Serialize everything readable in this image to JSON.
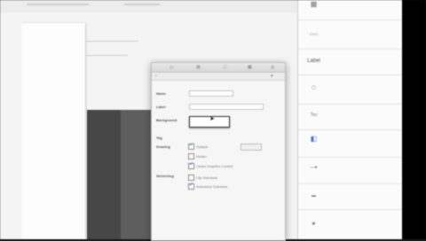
{
  "inspector": {
    "toolbar_icons": [
      "document-icon",
      "tab-icon",
      "circle-info-icon",
      "ruler-icon",
      "link-icon"
    ],
    "rows": {
      "name_label": "Name",
      "name_value": "",
      "label_label": "Label",
      "background_label": "Background",
      "tag_label": "Tag",
      "drawing_label": "Drawing",
      "stretching_label": "Stretching"
    },
    "checkboxes": [
      {
        "label": "Opaque",
        "checked": true
      },
      {
        "label": "Hidden",
        "checked": false
      },
      {
        "label": "Clears Graphics Context",
        "checked": true
      },
      {
        "label": "Clip Subviews",
        "checked": false
      },
      {
        "label": "Autoresize Subviews",
        "checked": true
      }
    ],
    "small_button_label": ""
  },
  "library": {
    "items": [
      {
        "icon": "table-icon",
        "title": "",
        "desc": ""
      },
      {
        "icon": "segmented-control-icon",
        "title": "",
        "desc": ""
      },
      {
        "icon": "label-icon",
        "icon_text": "Label",
        "title": "",
        "desc": ""
      },
      {
        "icon": "button-icon",
        "title": "",
        "desc": ""
      },
      {
        "icon": "text-field-icon",
        "title": "",
        "desc": ""
      },
      {
        "icon": "switch-icon",
        "title": "",
        "desc": ""
      },
      {
        "icon": "slider-icon",
        "title": "",
        "desc": ""
      },
      {
        "icon": "progress-view-icon",
        "title": "",
        "desc": ""
      },
      {
        "icon": "activity-indicator-icon",
        "title": "",
        "desc": ""
      }
    ]
  }
}
